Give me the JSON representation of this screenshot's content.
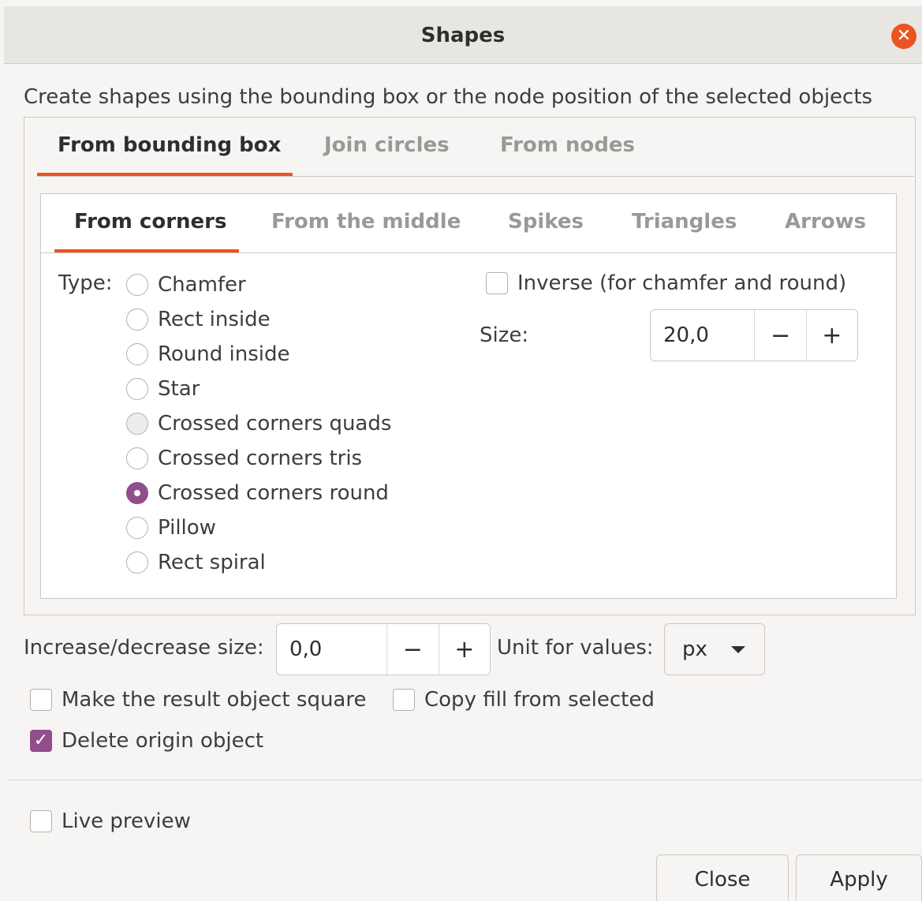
{
  "window": {
    "title": "Shapes",
    "close_glyph": "✕"
  },
  "description": "Create shapes using the bounding box or the node position of the selected objects",
  "main_tabs": [
    {
      "label": "From bounding box",
      "active": true
    },
    {
      "label": "Join circles",
      "active": false
    },
    {
      "label": "From nodes",
      "active": false
    }
  ],
  "sub_tabs": [
    {
      "label": "From corners",
      "active": true
    },
    {
      "label": "From the middle",
      "active": false
    },
    {
      "label": "Spikes",
      "active": false
    },
    {
      "label": "Triangles",
      "active": false
    },
    {
      "label": "Arrows",
      "active": false
    }
  ],
  "type": {
    "label": "Type:",
    "options": [
      {
        "label": "Chamfer",
        "selected": false
      },
      {
        "label": "Rect inside",
        "selected": false
      },
      {
        "label": "Round inside",
        "selected": false
      },
      {
        "label": "Star",
        "selected": false
      },
      {
        "label": "Crossed corners quads",
        "selected": false
      },
      {
        "label": "Crossed corners tris",
        "selected": false
      },
      {
        "label": "Crossed corners round",
        "selected": true
      },
      {
        "label": "Pillow",
        "selected": false
      },
      {
        "label": "Rect spiral",
        "selected": false
      }
    ]
  },
  "inverse": {
    "label": "Inverse (for chamfer and round)",
    "checked": false
  },
  "size": {
    "label": "Size:",
    "value": "20,0",
    "minus": "−",
    "plus": "+"
  },
  "increase": {
    "label": "Increase/decrease size:",
    "value": "0,0",
    "minus": "−",
    "plus": "+"
  },
  "unit": {
    "label": "Unit for values:",
    "value": "px"
  },
  "options": {
    "make_square": {
      "label": "Make the result object square",
      "checked": false
    },
    "copy_fill": {
      "label": "Copy fill from selected",
      "checked": false
    },
    "delete_origin": {
      "label": "Delete origin object",
      "checked": true
    }
  },
  "live_preview": {
    "label": "Live preview",
    "checked": false
  },
  "buttons": {
    "close": "Close",
    "apply": "Apply"
  },
  "colors": {
    "accent": "#e95420",
    "selection": "#924d8b"
  }
}
